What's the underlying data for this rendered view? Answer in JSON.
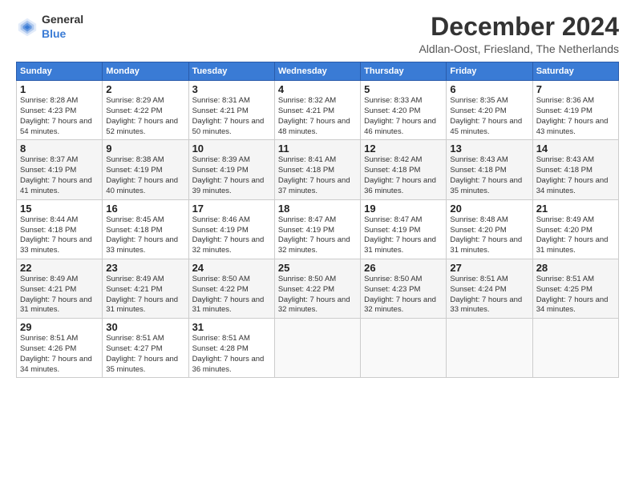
{
  "logo": {
    "text_general": "General",
    "text_blue": "Blue"
  },
  "header": {
    "title": "December 2024",
    "subtitle": "Aldlan-Oost, Friesland, The Netherlands"
  },
  "calendar": {
    "days_of_week": [
      "Sunday",
      "Monday",
      "Tuesday",
      "Wednesday",
      "Thursday",
      "Friday",
      "Saturday"
    ],
    "weeks": [
      [
        {
          "day": "",
          "sunrise": "",
          "sunset": "",
          "daylight": ""
        },
        {
          "day": "2",
          "sunrise": "Sunrise: 8:29 AM",
          "sunset": "Sunset: 4:22 PM",
          "daylight": "Daylight: 7 hours and 52 minutes."
        },
        {
          "day": "3",
          "sunrise": "Sunrise: 8:31 AM",
          "sunset": "Sunset: 4:21 PM",
          "daylight": "Daylight: 7 hours and 50 minutes."
        },
        {
          "day": "4",
          "sunrise": "Sunrise: 8:32 AM",
          "sunset": "Sunset: 4:21 PM",
          "daylight": "Daylight: 7 hours and 48 minutes."
        },
        {
          "day": "5",
          "sunrise": "Sunrise: 8:33 AM",
          "sunset": "Sunset: 4:20 PM",
          "daylight": "Daylight: 7 hours and 46 minutes."
        },
        {
          "day": "6",
          "sunrise": "Sunrise: 8:35 AM",
          "sunset": "Sunset: 4:20 PM",
          "daylight": "Daylight: 7 hours and 45 minutes."
        },
        {
          "day": "7",
          "sunrise": "Sunrise: 8:36 AM",
          "sunset": "Sunset: 4:19 PM",
          "daylight": "Daylight: 7 hours and 43 minutes."
        }
      ],
      [
        {
          "day": "1",
          "sunrise": "Sunrise: 8:28 AM",
          "sunset": "Sunset: 4:23 PM",
          "daylight": "Daylight: 7 hours and 54 minutes."
        },
        {
          "day": "9",
          "sunrise": "Sunrise: 8:38 AM",
          "sunset": "Sunset: 4:19 PM",
          "daylight": "Daylight: 7 hours and 40 minutes."
        },
        {
          "day": "10",
          "sunrise": "Sunrise: 8:39 AM",
          "sunset": "Sunset: 4:19 PM",
          "daylight": "Daylight: 7 hours and 39 minutes."
        },
        {
          "day": "11",
          "sunrise": "Sunrise: 8:41 AM",
          "sunset": "Sunset: 4:18 PM",
          "daylight": "Daylight: 7 hours and 37 minutes."
        },
        {
          "day": "12",
          "sunrise": "Sunrise: 8:42 AM",
          "sunset": "Sunset: 4:18 PM",
          "daylight": "Daylight: 7 hours and 36 minutes."
        },
        {
          "day": "13",
          "sunrise": "Sunrise: 8:43 AM",
          "sunset": "Sunset: 4:18 PM",
          "daylight": "Daylight: 7 hours and 35 minutes."
        },
        {
          "day": "14",
          "sunrise": "Sunrise: 8:43 AM",
          "sunset": "Sunset: 4:18 PM",
          "daylight": "Daylight: 7 hours and 34 minutes."
        }
      ],
      [
        {
          "day": "8",
          "sunrise": "Sunrise: 8:37 AM",
          "sunset": "Sunset: 4:19 PM",
          "daylight": "Daylight: 7 hours and 41 minutes."
        },
        {
          "day": "16",
          "sunrise": "Sunrise: 8:45 AM",
          "sunset": "Sunset: 4:18 PM",
          "daylight": "Daylight: 7 hours and 33 minutes."
        },
        {
          "day": "17",
          "sunrise": "Sunrise: 8:46 AM",
          "sunset": "Sunset: 4:19 PM",
          "daylight": "Daylight: 7 hours and 32 minutes."
        },
        {
          "day": "18",
          "sunrise": "Sunrise: 8:47 AM",
          "sunset": "Sunset: 4:19 PM",
          "daylight": "Daylight: 7 hours and 32 minutes."
        },
        {
          "day": "19",
          "sunrise": "Sunrise: 8:47 AM",
          "sunset": "Sunset: 4:19 PM",
          "daylight": "Daylight: 7 hours and 31 minutes."
        },
        {
          "day": "20",
          "sunrise": "Sunrise: 8:48 AM",
          "sunset": "Sunset: 4:20 PM",
          "daylight": "Daylight: 7 hours and 31 minutes."
        },
        {
          "day": "21",
          "sunrise": "Sunrise: 8:49 AM",
          "sunset": "Sunset: 4:20 PM",
          "daylight": "Daylight: 7 hours and 31 minutes."
        }
      ],
      [
        {
          "day": "15",
          "sunrise": "Sunrise: 8:44 AM",
          "sunset": "Sunset: 4:18 PM",
          "daylight": "Daylight: 7 hours and 33 minutes."
        },
        {
          "day": "23",
          "sunrise": "Sunrise: 8:49 AM",
          "sunset": "Sunset: 4:21 PM",
          "daylight": "Daylight: 7 hours and 31 minutes."
        },
        {
          "day": "24",
          "sunrise": "Sunrise: 8:50 AM",
          "sunset": "Sunset: 4:22 PM",
          "daylight": "Daylight: 7 hours and 31 minutes."
        },
        {
          "day": "25",
          "sunrise": "Sunrise: 8:50 AM",
          "sunset": "Sunset: 4:22 PM",
          "daylight": "Daylight: 7 hours and 32 minutes."
        },
        {
          "day": "26",
          "sunrise": "Sunrise: 8:50 AM",
          "sunset": "Sunset: 4:23 PM",
          "daylight": "Daylight: 7 hours and 32 minutes."
        },
        {
          "day": "27",
          "sunrise": "Sunrise: 8:51 AM",
          "sunset": "Sunset: 4:24 PM",
          "daylight": "Daylight: 7 hours and 33 minutes."
        },
        {
          "day": "28",
          "sunrise": "Sunrise: 8:51 AM",
          "sunset": "Sunset: 4:25 PM",
          "daylight": "Daylight: 7 hours and 34 minutes."
        }
      ],
      [
        {
          "day": "22",
          "sunrise": "Sunrise: 8:49 AM",
          "sunset": "Sunset: 4:21 PM",
          "daylight": "Daylight: 7 hours and 31 minutes."
        },
        {
          "day": "30",
          "sunrise": "Sunrise: 8:51 AM",
          "sunset": "Sunset: 4:27 PM",
          "daylight": "Daylight: 7 hours and 35 minutes."
        },
        {
          "day": "31",
          "sunrise": "Sunrise: 8:51 AM",
          "sunset": "Sunset: 4:28 PM",
          "daylight": "Daylight: 7 hours and 36 minutes."
        },
        {
          "day": "",
          "sunrise": "",
          "sunset": "",
          "daylight": ""
        },
        {
          "day": "",
          "sunrise": "",
          "sunset": "",
          "daylight": ""
        },
        {
          "day": "",
          "sunrise": "",
          "sunset": "",
          "daylight": ""
        },
        {
          "day": "",
          "sunrise": "",
          "sunset": "",
          "daylight": ""
        }
      ],
      [
        {
          "day": "29",
          "sunrise": "Sunrise: 8:51 AM",
          "sunset": "Sunset: 4:26 PM",
          "daylight": "Daylight: 7 hours and 34 minutes."
        },
        {
          "day": "",
          "sunrise": "",
          "sunset": "",
          "daylight": ""
        },
        {
          "day": "",
          "sunrise": "",
          "sunset": "",
          "daylight": ""
        },
        {
          "day": "",
          "sunrise": "",
          "sunset": "",
          "daylight": ""
        },
        {
          "day": "",
          "sunrise": "",
          "sunset": "",
          "daylight": ""
        },
        {
          "day": "",
          "sunrise": "",
          "sunset": "",
          "daylight": ""
        },
        {
          "day": "",
          "sunrise": "",
          "sunset": "",
          "daylight": ""
        }
      ]
    ]
  }
}
